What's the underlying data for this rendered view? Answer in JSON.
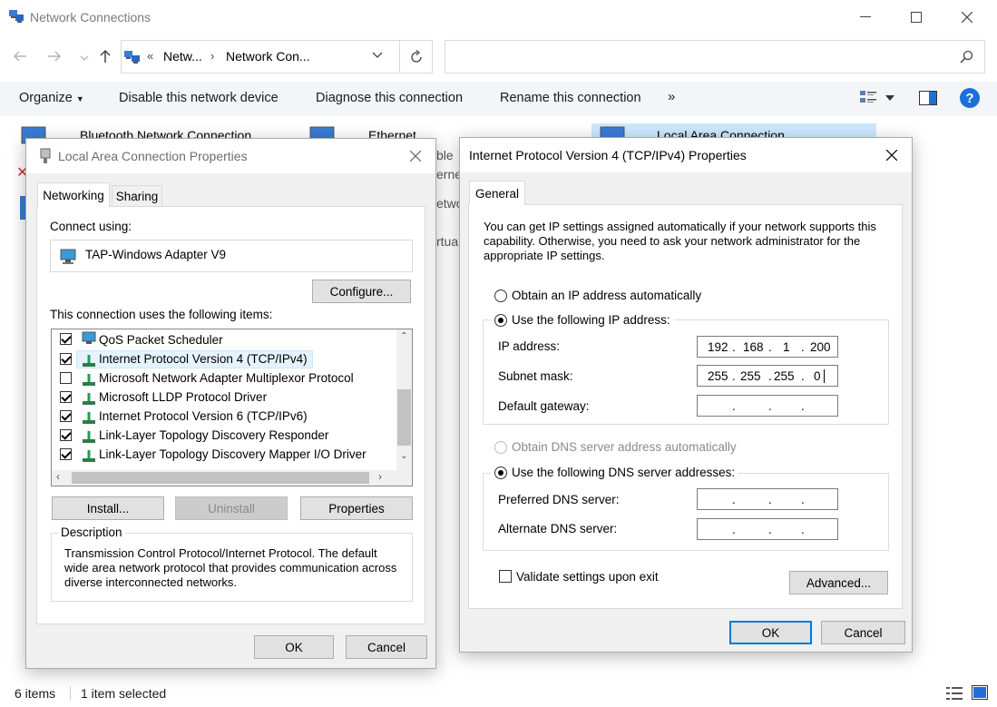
{
  "window": {
    "title": "Network Connections",
    "breadcrumb": [
      "Netw...",
      "Network Con..."
    ],
    "breadcrumb_prefix": "«"
  },
  "toolbar": {
    "organize": "Organize",
    "disable": "Disable this network device",
    "diagnose": "Diagnose this connection",
    "rename": "Rename this connection",
    "more": "»"
  },
  "connections": [
    {
      "name": "Bluetooth Network Connection"
    },
    {
      "name": "Ethernet"
    },
    {
      "name": "Local Area Connection"
    }
  ],
  "partial_texts": [
    "ble",
    "erne",
    "etwo",
    "rtual"
  ],
  "status": {
    "items": "6 items",
    "selected": "1 item selected"
  },
  "lac_dialog": {
    "title": "Local Area Connection Properties",
    "tabs": [
      "Networking",
      "Sharing"
    ],
    "connect_using_label": "Connect using:",
    "adapter": "TAP-Windows Adapter V9",
    "configure": "Configure...",
    "items_label": "This connection uses the following items:",
    "items": [
      {
        "label": "QoS Packet Scheduler",
        "checked": true
      },
      {
        "label": "Internet Protocol Version 4 (TCP/IPv4)",
        "checked": true
      },
      {
        "label": "Microsoft Network Adapter Multiplexor Protocol",
        "checked": false
      },
      {
        "label": "Microsoft LLDP Protocol Driver",
        "checked": true
      },
      {
        "label": "Internet Protocol Version 6 (TCP/IPv6)",
        "checked": true
      },
      {
        "label": "Link-Layer Topology Discovery Responder",
        "checked": true
      },
      {
        "label": "Link-Layer Topology Discovery Mapper I/O Driver",
        "checked": true
      }
    ],
    "install": "Install...",
    "uninstall": "Uninstall",
    "properties": "Properties",
    "description_label": "Description",
    "description": "Transmission Control Protocol/Internet Protocol. The default wide area network protocol that provides communication across diverse interconnected networks.",
    "ok": "OK",
    "cancel": "Cancel"
  },
  "ipv4_dialog": {
    "title": "Internet Protocol Version 4 (TCP/IPv4) Properties",
    "tab": "General",
    "intro": "You can get IP settings assigned automatically if your network supports this capability. Otherwise, you need to ask your network administrator for the appropriate IP settings.",
    "obtain_ip_auto": "Obtain an IP address automatically",
    "use_following_ip": "Use the following IP address:",
    "ip_label": "IP address:",
    "subnet_label": "Subnet mask:",
    "gateway_label": "Default gateway:",
    "ip_address": [
      "192",
      "168",
      "1",
      "200"
    ],
    "subnet_mask": [
      "255",
      "255",
      "255",
      "0"
    ],
    "gateway": [
      "",
      "",
      "",
      ""
    ],
    "obtain_dns_auto": "Obtain DNS server address automatically",
    "use_following_dns": "Use the following DNS server addresses:",
    "preferred_dns_label": "Preferred DNS server:",
    "alternate_dns_label": "Alternate DNS server:",
    "validate": "Validate settings upon exit",
    "advanced": "Advanced...",
    "ok": "OK",
    "cancel": "Cancel"
  },
  "colors": {
    "accent": "#0078d7",
    "command_bar": "#f3f5f8",
    "selection": "#cce8ff",
    "help": "#1e6fd9"
  }
}
